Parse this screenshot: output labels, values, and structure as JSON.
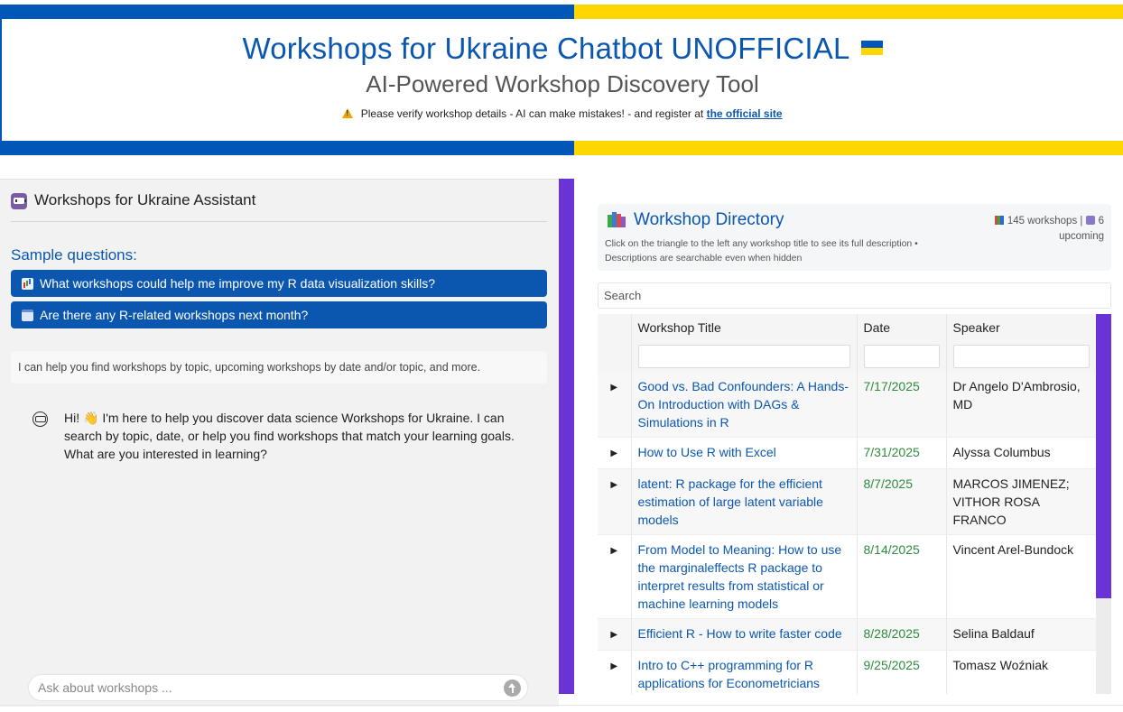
{
  "header": {
    "title": "Workshops for Ukraine Chatbot UNOFFICIAL",
    "subtitle": "AI-Powered Workshop Discovery Tool",
    "notice": "Please verify workshop details - AI can make mistakes! - and register at",
    "link_text": "the official site",
    "colors": {
      "blue": "#0057b7",
      "yellow": "#ffd700"
    }
  },
  "chat": {
    "title": "Workshops for Ukraine Assistant",
    "sample_label": "Sample questions:",
    "samples": [
      "What workshops could help me improve my R data visualization skills?",
      "Are there any R-related workshops next month?"
    ],
    "help_text": "I can help you find workshops by topic, upcoming workshops by date and/or topic, and more.",
    "bot_message": "Hi! 👋 I'm here to help you discover data science Workshops for Ukraine. I can search by topic, date, or help you find workshops that match your learning goals. What are you interested in learning?",
    "input_placeholder": "Ask about workshops ..."
  },
  "directory": {
    "title": "Workshop Directory",
    "description": "Click on the triangle to the left any workshop title to see its full description • Descriptions are searchable even when hidden",
    "stats_total": "145 workshops |",
    "stats_upcoming": "6 upcoming",
    "search_placeholder": "Search",
    "columns": [
      "Workshop Title",
      "Date",
      "Speaker"
    ],
    "rows": [
      {
        "title": "Good vs. Bad Confounders: A Hands-On Introduction with DAGs & Simulations in R",
        "date": "7/17/2025",
        "speaker": "Dr Angelo D'Ambrosio, MD"
      },
      {
        "title": "How to Use R with Excel",
        "date": "7/31/2025",
        "speaker": "Alyssa Columbus"
      },
      {
        "title": "latent: R package for the efficient estimation of large latent variable models",
        "date": "8/7/2025",
        "speaker": "MARCOS JIMENEZ; VITHOR ROSA FRANCO"
      },
      {
        "title": "From Model to Meaning: How to use the marginaleffects R package to interpret results from statistical or machine learning models",
        "date": "8/14/2025",
        "speaker": "Vincent Arel-Bundock"
      },
      {
        "title": "Efficient R - How to write faster code",
        "date": "8/28/2025",
        "speaker": "Selina Baldauf"
      },
      {
        "title": "Intro to C++ programming for R applications for Econometricians",
        "date": "9/25/2025",
        "speaker": "Tomasz Woźniak"
      }
    ],
    "accent": "#6933d6"
  }
}
